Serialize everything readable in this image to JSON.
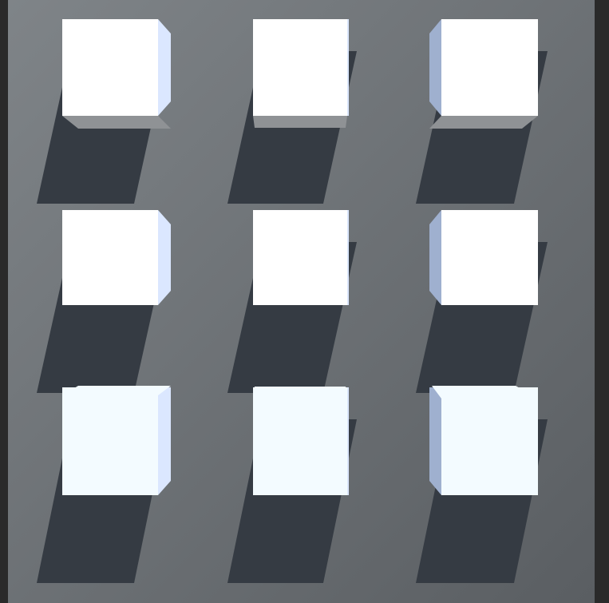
{
  "scene": {
    "colors": {
      "border": "#2a2a2a",
      "floor_light": "#7f8488",
      "floor_dark": "#5a5e62",
      "shadow": "#353b43",
      "cube_top": "#ffffff",
      "cube_face_light": "#f3fbff",
      "cube_side_blue": "#dbe7ff",
      "cube_side_steel": "#9fb0cf",
      "cube_bottom": "#8f9295"
    },
    "grid": {
      "rows": 3,
      "columns": 3,
      "cube_count": 9
    }
  }
}
